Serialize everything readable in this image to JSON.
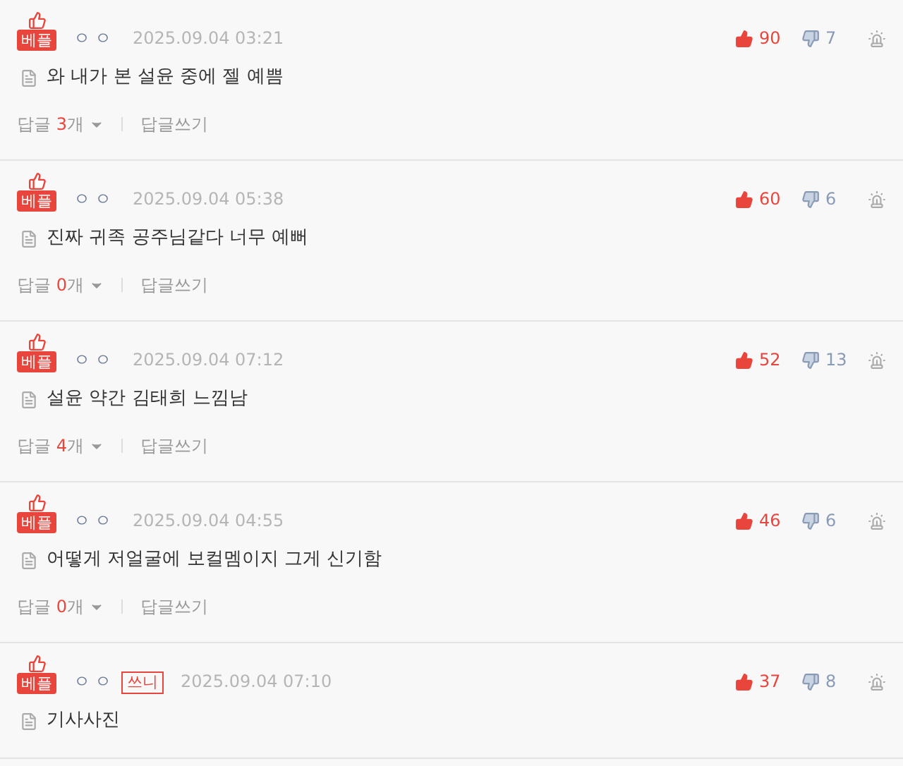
{
  "comments": [
    {
      "badge": "베플",
      "nickname": "ㅇㅇ",
      "date": "2025.09.04 03:21",
      "text": "와 내가 본 설윤 중에 젤 예쁨",
      "likes": "90",
      "dislikes": "7",
      "replies": {
        "label": "답글",
        "count": "3",
        "unit": "개",
        "write": "답글쓰기"
      }
    },
    {
      "badge": "베플",
      "nickname": "ㅇㅇ",
      "date": "2025.09.04 05:38",
      "text": "진짜 귀족 공주님같다 너무 예뻐",
      "likes": "60",
      "dislikes": "6",
      "replies": {
        "label": "답글",
        "count": "0",
        "unit": "개",
        "write": "답글쓰기"
      }
    },
    {
      "badge": "베플",
      "nickname": "ㅇㅇ",
      "date": "2025.09.04 07:12",
      "text": "설윤 약간 김태희 느낌남",
      "likes": "52",
      "dislikes": "13",
      "replies": {
        "label": "답글",
        "count": "4",
        "unit": "개",
        "write": "답글쓰기"
      }
    },
    {
      "badge": "베플",
      "nickname": "ㅇㅇ",
      "date": "2025.09.04 04:55",
      "text": "어떻게 저얼굴에 보컬멤이지 그게 신기함",
      "likes": "46",
      "dislikes": "6",
      "replies": {
        "label": "답글",
        "count": "0",
        "unit": "개",
        "write": "답글쓰기"
      }
    },
    {
      "badge": "베플",
      "nickname": "ㅇㅇ",
      "author_tag": "쓰니",
      "date": "2025.09.04 07:10",
      "text": "기사사진",
      "likes": "37",
      "dislikes": "8"
    }
  ]
}
